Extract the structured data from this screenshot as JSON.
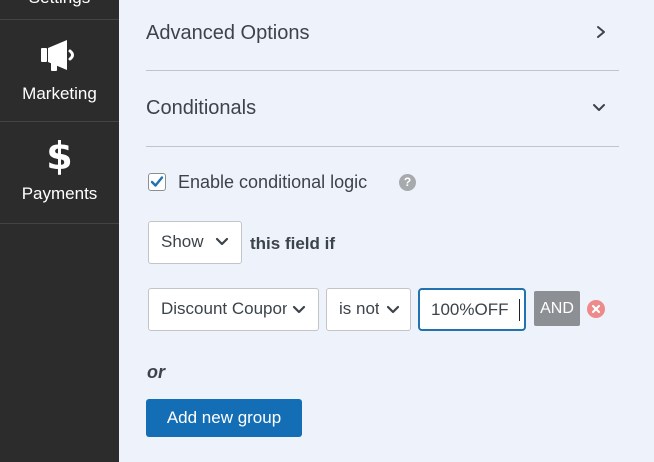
{
  "sidebar": {
    "partial_label": "Settings",
    "items": [
      {
        "label": "Marketing",
        "icon": "megaphone-icon"
      },
      {
        "label": "Payments",
        "icon": "dollar-icon"
      }
    ]
  },
  "sections": {
    "advanced": {
      "title": "Advanced Options",
      "state": "collapsed"
    },
    "conditionals": {
      "title": "Conditionals",
      "state": "expanded"
    }
  },
  "conditional_logic": {
    "enable_label": "Enable conditional logic",
    "enabled": true,
    "action_select": "Show",
    "field_if_label": "this field if",
    "rule": {
      "field_select": "Discount Coupon",
      "operator_select": "is not",
      "value": "100%OFF",
      "and_label": "AND"
    },
    "or_label": "or",
    "add_group_label": "Add new group"
  },
  "colors": {
    "sidebar_bg": "#2c2c2c",
    "main_bg": "#eef3fb",
    "primary_blue": "#136eb5",
    "focus_border": "#2271b1",
    "and_button_bg": "#8c8f94",
    "remove_icon": "#ee8a8a"
  }
}
